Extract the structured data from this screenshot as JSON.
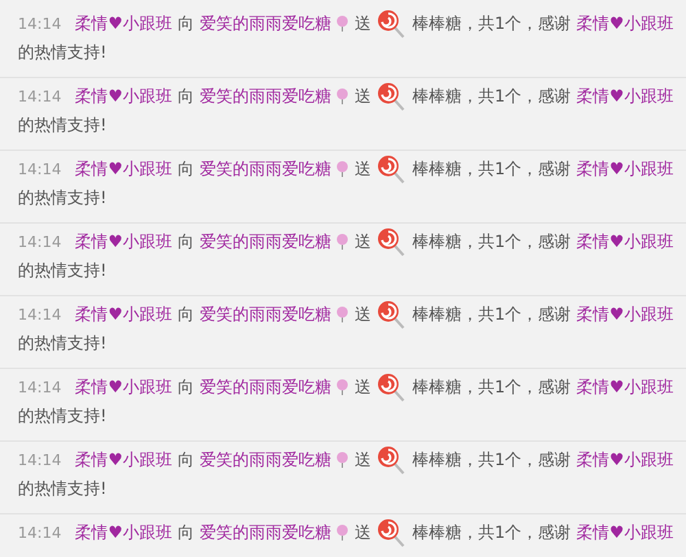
{
  "messages": [
    {
      "time": "14:14",
      "sender": "柔情♥小跟班",
      "verb": "向",
      "receiver": "爱笑的雨雨爱吃糖",
      "action": "送",
      "gift": "棒棒糖，共1个，感谢",
      "thanker": "柔情♥小跟班",
      "tail": "的热情支持!"
    },
    {
      "time": "14:14",
      "sender": "柔情♥小跟班",
      "verb": "向",
      "receiver": "爱笑的雨雨爱吃糖",
      "action": "送",
      "gift": "棒棒糖，共1个，感谢",
      "thanker": "柔情♥小跟班",
      "tail": "的热情支持!"
    },
    {
      "time": "14:14",
      "sender": "柔情♥小跟班",
      "verb": "向",
      "receiver": "爱笑的雨雨爱吃糖",
      "action": "送",
      "gift": "棒棒糖，共1个，感谢",
      "thanker": "柔情♥小跟班",
      "tail": "的热情支持!"
    },
    {
      "time": "14:14",
      "sender": "柔情♥小跟班",
      "verb": "向",
      "receiver": "爱笑的雨雨爱吃糖",
      "action": "送",
      "gift": "棒棒糖，共1个，感谢",
      "thanker": "柔情♥小跟班",
      "tail": "的热情支持!"
    },
    {
      "time": "14:14",
      "sender": "柔情♥小跟班",
      "verb": "向",
      "receiver": "爱笑的雨雨爱吃糖",
      "action": "送",
      "gift": "棒棒糖，共1个，感谢",
      "thanker": "柔情♥小跟班",
      "tail": "的热情支持!"
    },
    {
      "time": "14:14",
      "sender": "柔情♥小跟班",
      "verb": "向",
      "receiver": "爱笑的雨雨爱吃糖",
      "action": "送",
      "gift": "棒棒糖，共1个，感谢",
      "thanker": "柔情♥小跟班",
      "tail": "的热情支持!"
    },
    {
      "time": "14:14",
      "sender": "柔情♥小跟班",
      "verb": "向",
      "receiver": "爱笑的雨雨爱吃糖",
      "action": "送",
      "gift": "棒棒糖，共1个，感谢",
      "thanker": "柔情♥小跟班",
      "tail": "的热情支持!"
    },
    {
      "time": "14:14",
      "sender": "柔情♥小跟班",
      "verb": "向",
      "receiver": "爱笑的雨雨爱吃糖",
      "action": "送",
      "gift": "棒棒糖，共1个，感谢",
      "thanker": "柔情♥小跟班"
    }
  ]
}
